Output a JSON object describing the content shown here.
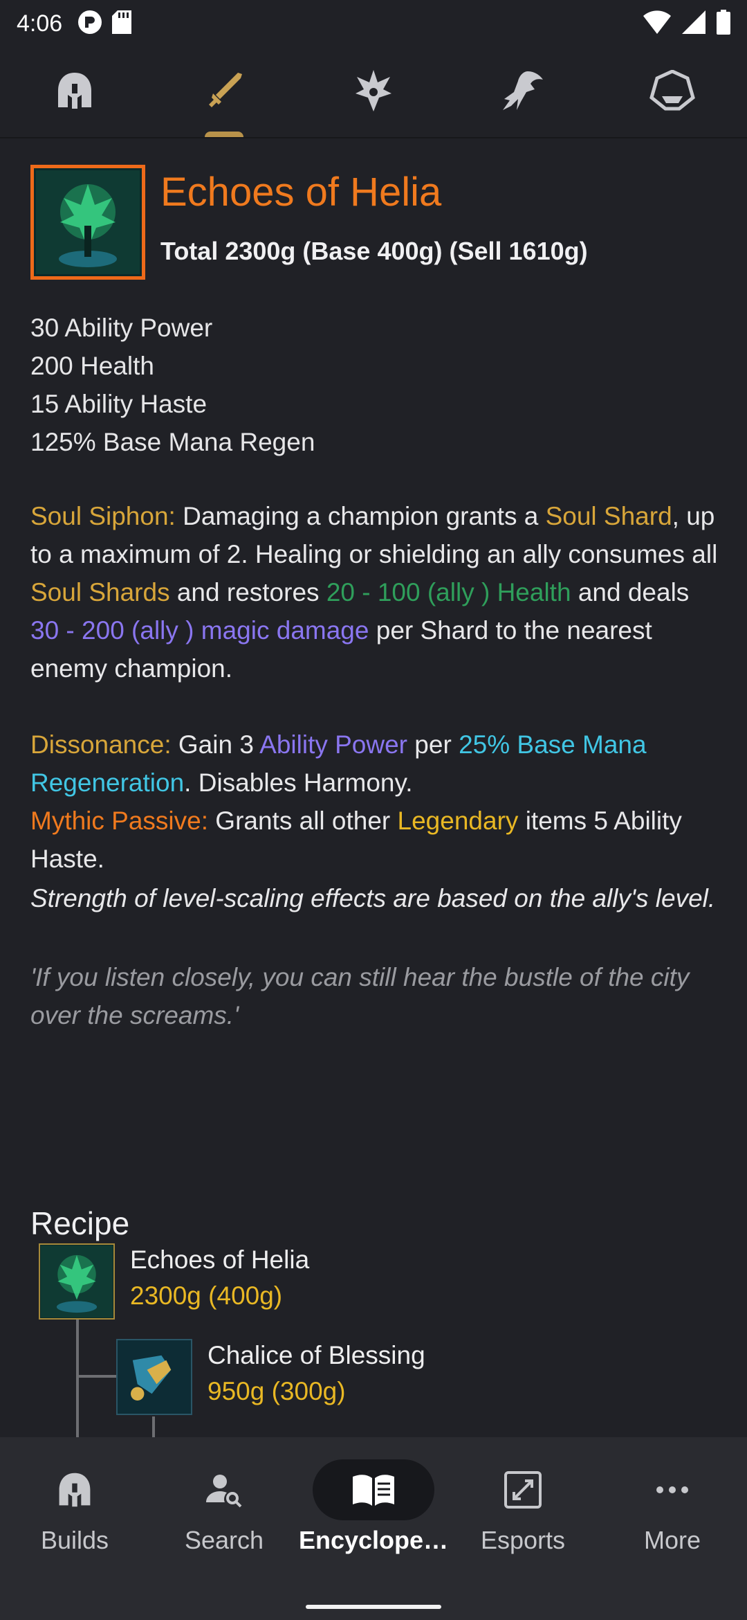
{
  "status": {
    "time": "4:06"
  },
  "top_tabs": [
    {
      "name": "champions-tab",
      "icon": "helmet-icon",
      "active": false
    },
    {
      "name": "items-tab",
      "icon": "sword-icon",
      "active": true
    },
    {
      "name": "runes-tab",
      "icon": "rune-icon",
      "active": false
    },
    {
      "name": "summoner-spells-tab",
      "icon": "flash-icon",
      "active": false
    },
    {
      "name": "ranks-tab",
      "icon": "rank-crest-icon",
      "active": false
    }
  ],
  "item": {
    "name": "Echoes of Helia",
    "cost": "Total 2300g (Base 400g) (Sell 1610g)",
    "stats": [
      {
        "value": "30",
        "label": "Ability Power"
      },
      {
        "value": "200",
        "label": "Health"
      },
      {
        "value": "15",
        "label": "Ability Haste"
      },
      {
        "value": "125%",
        "label": "Base Mana Regen"
      }
    ],
    "soul_siphon": {
      "name": "Soul Siphon:",
      "t1": "Damaging a champion grants a",
      "k1": "Soul Shard",
      "t2": ", up to a maximum of 2. Healing or shielding an ally consumes all",
      "k2": "Soul Shards",
      "t3": "and restores",
      "heal": "20 - 100 (ally ) Health",
      "t4": "and deals",
      "dmg": "30 - 200 (ally ) magic damage",
      "t5": "per Shard to the nearest enemy champion."
    },
    "dissonance": {
      "name": "Dissonance:",
      "t1": "Gain 3",
      "k1": "Ability Power",
      "t2": "per",
      "k2": "25% Base Mana Regeneration",
      "t3": ". Disables Harmony."
    },
    "mythic": {
      "name": "Mythic Passive:",
      "t1": "Grants all other",
      "k1": "Legendary",
      "t2": "items 5 Ability Haste."
    },
    "note": "Strength of level-scaling effects are based on the ally's level.",
    "quote": "'If you listen closely, you can still hear the bustle of the city over the screams.'"
  },
  "recipe": {
    "title": "Recipe",
    "items": [
      {
        "name": "Echoes of Helia",
        "cost": "2300g (400g)"
      },
      {
        "name": "Chalice of Blessing",
        "cost": "950g (300g)"
      }
    ]
  },
  "bottom_nav": [
    {
      "label": "Builds",
      "icon": "helmet-icon",
      "active": false
    },
    {
      "label": "Search",
      "icon": "person-search-icon",
      "active": false
    },
    {
      "label": "Encyclope…",
      "icon": "book-icon",
      "active": true
    },
    {
      "label": "Esports",
      "icon": "expand-icon",
      "active": false
    },
    {
      "label": "More",
      "icon": "more-dots-icon",
      "active": false
    }
  ],
  "colors": {
    "background": "#202126",
    "title_orange": "#f07a1e",
    "keyword_gold": "#d8a63a",
    "heal_green": "#2f9f5b",
    "magic_purple": "#8a76f0",
    "mana_cyan": "#41c6e4",
    "gold_cost": "#e9b824"
  }
}
